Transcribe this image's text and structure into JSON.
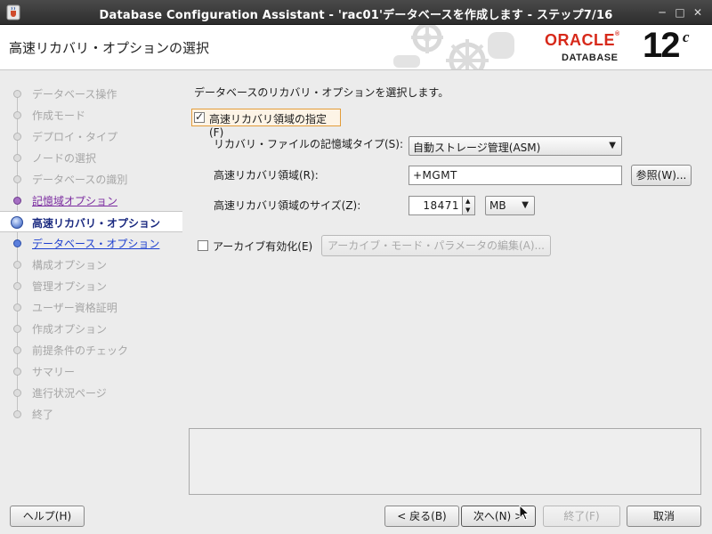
{
  "window": {
    "title": "Database Configuration Assistant - 'rac01'データベースを作成します - ステップ7/16"
  },
  "header": {
    "page_title": "高速リカバリ・オプションの選択",
    "oracle_logo": "ORACLE",
    "database_label": "DATABASE",
    "version": "12",
    "version_suffix": "c"
  },
  "steps": [
    {
      "label": "データベース操作",
      "state": "done"
    },
    {
      "label": "作成モード",
      "state": "done"
    },
    {
      "label": "デプロイ・タイプ",
      "state": "done"
    },
    {
      "label": "ノードの選択",
      "state": "done"
    },
    {
      "label": "データベースの識別",
      "state": "done"
    },
    {
      "label": "記憶域オプション",
      "state": "visited"
    },
    {
      "label": "高速リカバリ・オプション",
      "state": "current"
    },
    {
      "label": "データベース・オプション",
      "state": "future"
    },
    {
      "label": "構成オプション",
      "state": "disabled"
    },
    {
      "label": "管理オプション",
      "state": "disabled"
    },
    {
      "label": "ユーザー資格証明",
      "state": "disabled"
    },
    {
      "label": "作成オプション",
      "state": "disabled"
    },
    {
      "label": "前提条件のチェック",
      "state": "disabled"
    },
    {
      "label": "サマリー",
      "state": "disabled"
    },
    {
      "label": "進行状況ページ",
      "state": "disabled"
    },
    {
      "label": "終了",
      "state": "disabled"
    }
  ],
  "main": {
    "intro": "データベースのリカバリ・オプションを選択します。",
    "fra_checkbox_label": "高速リカバリ領域の指定(F)",
    "fra_checked": true,
    "storage_type_label": "リカバリ・ファイルの記憶域タイプ(S):",
    "storage_type_value": "自動ストレージ管理(ASM)",
    "fra_location_label": "高速リカバリ領域(R):",
    "fra_location_value": "+MGMT",
    "browse_button": "参照(W)...",
    "fra_size_label": "高速リカバリ領域のサイズ(Z):",
    "fra_size_value": "18471",
    "fra_size_unit": "MB",
    "archive_checkbox_label": "アーカイブ有効化(E)",
    "archive_checked": false,
    "archive_params_button": "アーカイブ・モード・パラメータの編集(A)..."
  },
  "buttons": {
    "help": "ヘルプ(H)",
    "back": "< 戻る(B)",
    "next": "次へ(N) >",
    "finish": "終了(F)",
    "cancel": "取消"
  },
  "colors": {
    "oracle_red": "#d7291a",
    "visited_step": "#7b2ca0",
    "future_step": "#1d3fcf",
    "current_step": "#1b2a80"
  }
}
